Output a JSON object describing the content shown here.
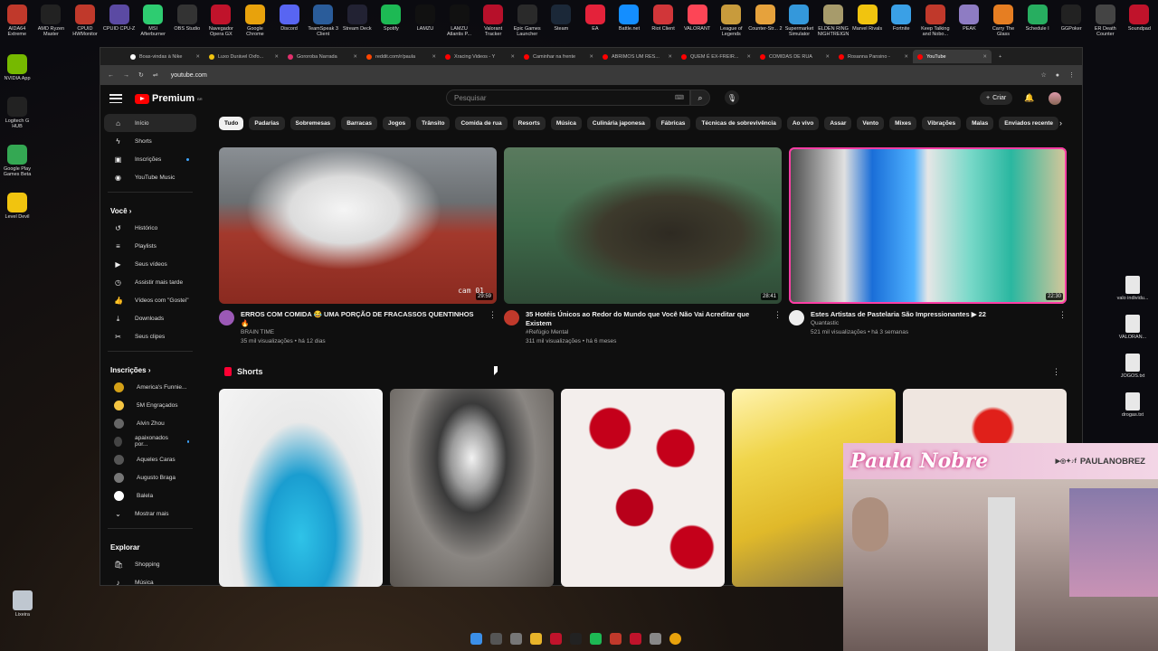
{
  "desktop": {
    "top_icons": [
      {
        "label": "AIDA64 Extreme",
        "color": "#c0392b"
      },
      {
        "label": "AMD Ryzen Master",
        "color": "#222"
      },
      {
        "label": "CPUID HWMonitor",
        "color": "#c0392b"
      },
      {
        "label": "CPUID CPU-Z",
        "color": "#5b4aa3"
      },
      {
        "label": "MSI Afterburner",
        "color": "#2ecc71"
      },
      {
        "label": "OBS Studio",
        "color": "#333"
      },
      {
        "label": "Navegador Opera GX",
        "color": "#c0132b"
      },
      {
        "label": "Google Chrome",
        "color": "#e8a20c"
      },
      {
        "label": "Discord",
        "color": "#5865f2"
      },
      {
        "label": "TeamSpeak 3 Client",
        "color": "#2a5c9a"
      },
      {
        "label": "Stream Deck",
        "color": "#223"
      },
      {
        "label": "Spotify",
        "color": "#1db954"
      },
      {
        "label": "LAMZU",
        "color": "#111"
      },
      {
        "label": "LAMZU Atlantis P...",
        "color": "#111"
      },
      {
        "label": "Valorant Tracker",
        "color": "#b7102a"
      },
      {
        "label": "Epic Games Launcher",
        "color": "#2a2a2a"
      },
      {
        "label": "Steam",
        "color": "#1b2838"
      },
      {
        "label": "EA",
        "color": "#e4223a"
      },
      {
        "label": "Battle.net",
        "color": "#148eff"
      },
      {
        "label": "Riot Client",
        "color": "#d13639"
      },
      {
        "label": "VALORANT",
        "color": "#fd4556"
      },
      {
        "label": "League of Legends",
        "color": "#c89b3c"
      },
      {
        "label": "Counter-Str... 2",
        "color": "#e6a23c"
      },
      {
        "label": "Supermarket Simulator",
        "color": "#3498db"
      },
      {
        "label": "ELDEN RING NIGHTREIGN",
        "color": "#a79b6b"
      },
      {
        "label": "Marvel Rivals",
        "color": "#f1c40f"
      },
      {
        "label": "Fortnite",
        "color": "#3aa0e6"
      },
      {
        "label": "Keep Talking and Nobo...",
        "color": "#c0392b"
      },
      {
        "label": "PEAK",
        "color": "#8e7cc3"
      },
      {
        "label": "Carry The Glass",
        "color": "#e67e22"
      },
      {
        "label": "Schedule I",
        "color": "#27ae60"
      },
      {
        "label": "GGPoker",
        "color": "#222"
      },
      {
        "label": "ER Death Counter",
        "color": "#444"
      },
      {
        "label": "Soundpad",
        "color": "#c0132b"
      }
    ],
    "left_icons": [
      {
        "label": "NVIDIA App",
        "color": "#76b900"
      },
      {
        "label": "Logitech G HUB",
        "color": "#222"
      },
      {
        "label": "Google Play Games Beta",
        "color": "#34a853"
      },
      {
        "label": "Level Devil",
        "color": "#f1c40f"
      }
    ],
    "right_icons": [
      {
        "label": "valo individu..."
      },
      {
        "label": "VALORAN..."
      },
      {
        "label": "JOGOS.txt"
      },
      {
        "label": "drogas.txt"
      }
    ],
    "recycle_bin": "Lixeira"
  },
  "browser": {
    "tabs": [
      {
        "label": "Boas-vindas à Nike",
        "color": "#fff"
      },
      {
        "label": "Luxo Durável Oxfo...",
        "color": "#f1c40f"
      },
      {
        "label": "Gororoba Narrada",
        "color": "#e1306c"
      },
      {
        "label": "reddit.com/r/paula",
        "color": "#ff4500"
      },
      {
        "label": "Xracing Videos - Y",
        "color": "#ff0000"
      },
      {
        "label": "Caminhar na frente",
        "color": "#ff0000"
      },
      {
        "label": "ABRIMOS UM RES...",
        "color": "#ff0000"
      },
      {
        "label": "QUEM É EX-FREIR...",
        "color": "#ff0000"
      },
      {
        "label": "COMIDAS DE RUA",
        "color": "#ff0000"
      },
      {
        "label": "Rosanna Pansino -",
        "color": "#ff0000"
      },
      {
        "label": "YouTube",
        "color": "#ff0000",
        "active": true
      }
    ],
    "url": "youtube.com"
  },
  "youtube": {
    "logo": "Premium",
    "logo_sup": "BR",
    "search_placeholder": "Pesquisar",
    "create_label": "Criar",
    "sidebar": {
      "main": [
        {
          "label": "Início",
          "icon": "⌂",
          "active": true
        },
        {
          "label": "Shorts",
          "icon": "ϟ"
        },
        {
          "label": "Inscrições",
          "icon": "▣",
          "dot": true
        },
        {
          "label": "YouTube Music",
          "icon": "◉"
        }
      ],
      "you_header": "Você",
      "you": [
        {
          "label": "Histórico",
          "icon": "↺"
        },
        {
          "label": "Playlists",
          "icon": "≡"
        },
        {
          "label": "Seus vídeos",
          "icon": "▶"
        },
        {
          "label": "Assistir mais tarde",
          "icon": "◷"
        },
        {
          "label": "Vídeos com \"Gostei\"",
          "icon": "👍"
        },
        {
          "label": "Downloads",
          "icon": "⤓"
        },
        {
          "label": "Seus clipes",
          "icon": "✂"
        }
      ],
      "subs_header": "Inscrições",
      "subs": [
        {
          "label": "America's Funnie...",
          "color": "#d4a017"
        },
        {
          "label": "5M Engraçados",
          "color": "#f5c542"
        },
        {
          "label": "Alvin Zhou",
          "color": "#666"
        },
        {
          "label": "apaixonados por...",
          "color": "#444",
          "dot": true
        },
        {
          "label": "Aqueles Caras",
          "color": "#555"
        },
        {
          "label": "Augusto Braga",
          "color": "#777"
        },
        {
          "label": "Balela",
          "color": "#fff"
        }
      ],
      "show_more": "Mostrar mais",
      "explore_header": "Explorar",
      "explore": [
        {
          "label": "Shopping",
          "icon": "🛍"
        },
        {
          "label": "Música",
          "icon": "♪"
        }
      ]
    },
    "chips": [
      "Tudo",
      "Padarias",
      "Sobremesas",
      "Barracas",
      "Jogos",
      "Trânsito",
      "Comida de rua",
      "Resorts",
      "Música",
      "Culinária japonesa",
      "Fábricas",
      "Técnicas de sobrevivência",
      "Ao vivo",
      "Assar",
      "Vento",
      "Mixes",
      "Vibrações",
      "Malas",
      "Enviados recente"
    ],
    "videos": [
      {
        "title": "ERROS COM COMIDA 😂 UMA PORÇÃO DE FRACASSOS QUENTINHOS 🔥",
        "channel": "BRAIN TIME",
        "stats": "35 mil visualizações • há 12 dias",
        "duration": "29:59",
        "overlay": "cam 01",
        "channel_color": "#9b59b6"
      },
      {
        "title": "35 Hotéis Únicos ao Redor do Mundo que Você Não Vai Acreditar que Existem",
        "channel": "#Refúgio Mental",
        "stats": "311 mil visualizações • há 6 meses",
        "duration": "28:41",
        "channel_color": "#c0392b"
      },
      {
        "title": "Estes Artistas de Pastelaria São Impressionantes ▶ 22",
        "channel": "Quantastic",
        "stats": "521 mil visualizações • há 3 semanas",
        "duration": "22:30",
        "channel_color": "#eee"
      }
    ],
    "shorts_label": "Shorts"
  },
  "cam": {
    "name": "Paula Nobre",
    "handle": "PAULANOBREZ"
  }
}
